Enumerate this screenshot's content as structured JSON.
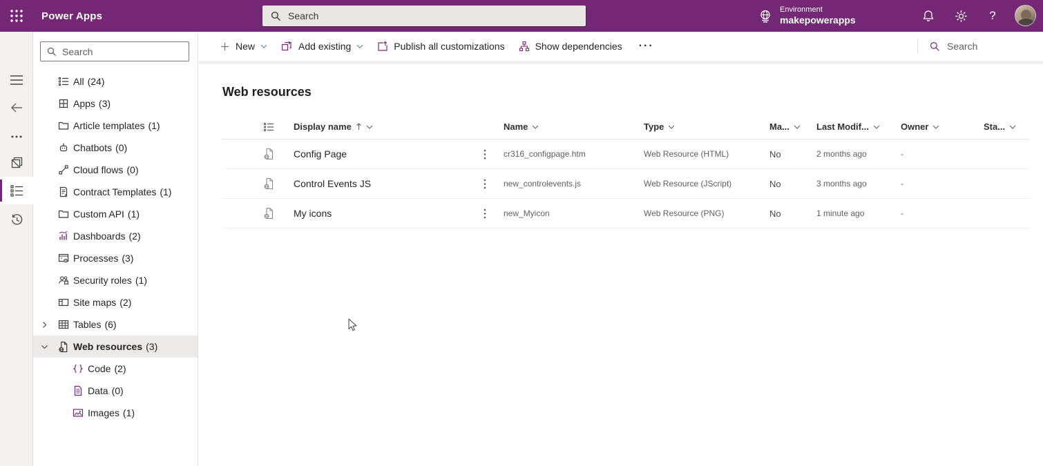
{
  "topbar": {
    "app_title": "Power Apps",
    "search_placeholder": "Search",
    "environment_label": "Environment",
    "environment_name": "makepowerapps"
  },
  "nav": {
    "search_placeholder": "Search",
    "items": [
      {
        "icon": "all-icon",
        "label": "All",
        "count": "(24)"
      },
      {
        "icon": "apps-icon",
        "label": "Apps",
        "count": "(3)"
      },
      {
        "icon": "folder-icon",
        "label": "Article templates",
        "count": "(1)"
      },
      {
        "icon": "chatbot-icon",
        "label": "Chatbots",
        "count": "(0)"
      },
      {
        "icon": "cloud-flow-icon",
        "label": "Cloud flows",
        "count": "(0)"
      },
      {
        "icon": "contract-icon",
        "label": "Contract Templates",
        "count": "(1)"
      },
      {
        "icon": "folder-icon",
        "label": "Custom API",
        "count": "(1)"
      },
      {
        "icon": "dashboard-icon",
        "label": "Dashboards",
        "count": "(2)"
      },
      {
        "icon": "process-icon",
        "label": "Processes",
        "count": "(3)"
      },
      {
        "icon": "security-icon",
        "label": "Security roles",
        "count": "(1)"
      },
      {
        "icon": "sitemap-icon",
        "label": "Site maps",
        "count": "(2)"
      },
      {
        "icon": "table-icon",
        "label": "Tables",
        "count": "(6)",
        "expandable": true
      },
      {
        "icon": "web-resource-icon",
        "label": "Web resources",
        "count": "(3)",
        "expanded": true,
        "selected": true
      },
      {
        "icon": "code-icon",
        "label": "Code",
        "count": "(2)",
        "child": true
      },
      {
        "icon": "data-icon",
        "label": "Data",
        "count": "(0)",
        "child": true
      },
      {
        "icon": "image-icon",
        "label": "Images",
        "count": "(1)",
        "child": true
      }
    ]
  },
  "command_bar": {
    "new_label": "New",
    "add_existing_label": "Add existing",
    "publish_label": "Publish all customizations",
    "show_dependencies_label": "Show dependencies",
    "overflow_label": "···",
    "search_placeholder": "Search"
  },
  "main": {
    "page_title": "Web resources",
    "table": {
      "columns": [
        "Display name",
        "Name",
        "Type",
        "Ma...",
        "Last Modif...",
        "Owner",
        "Sta..."
      ],
      "rows": [
        {
          "display_name": "Config Page",
          "name": "cr316_configpage.htm",
          "type": "Web Resource (HTML)",
          "managed": "No",
          "last_modified": "2 months ago",
          "owner": "-",
          "status": ""
        },
        {
          "display_name": "Control Events JS",
          "name": "new_controlevents.js",
          "type": "Web Resource (JScript)",
          "managed": "No",
          "last_modified": "3 months ago",
          "owner": "-",
          "status": ""
        },
        {
          "display_name": "My icons",
          "name": "new_Myicon",
          "type": "Web Resource (PNG)",
          "managed": "No",
          "last_modified": "1 minute ago",
          "owner": "-",
          "status": ""
        }
      ]
    }
  },
  "colors": {
    "brand": "#742774",
    "text": "#323130",
    "secondary_text": "#605e5c"
  }
}
